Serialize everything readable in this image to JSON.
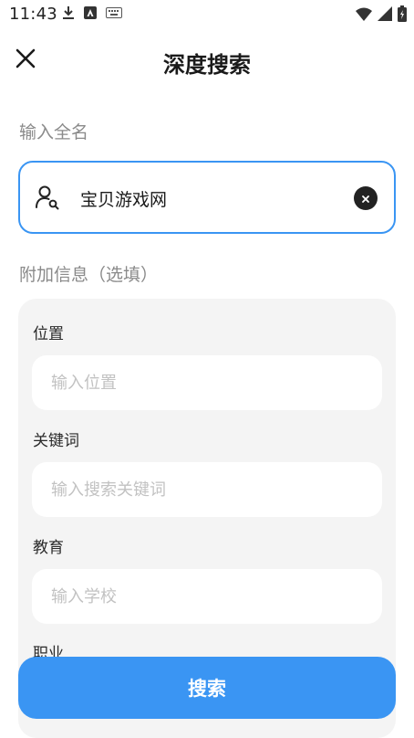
{
  "status_bar": {
    "time": "11:43",
    "left_icons": [
      "download-icon",
      "app-icon",
      "keyboard-icon"
    ],
    "right_icons": [
      "wifi-icon",
      "signal-icon",
      "battery-icon"
    ]
  },
  "header": {
    "title": "深度搜索",
    "close_icon": "close-icon"
  },
  "name_section": {
    "label": "输入全名",
    "value": "宝贝游戏网",
    "icon": "person-search-icon",
    "clear_icon": "clear-icon"
  },
  "extra_section": {
    "label": "附加信息（选填）",
    "fields": [
      {
        "label": "位置",
        "placeholder": "输入位置"
      },
      {
        "label": "关键词",
        "placeholder": "输入搜索关键词"
      },
      {
        "label": "教育",
        "placeholder": "输入学校"
      },
      {
        "label": "职业"
      }
    ]
  },
  "actions": {
    "search_label": "搜索"
  },
  "colors": {
    "accent": "#3a95f3",
    "panel_bg": "#f4f4f4",
    "placeholder": "#c2c2c2",
    "label_gray": "#8a8a8a"
  }
}
